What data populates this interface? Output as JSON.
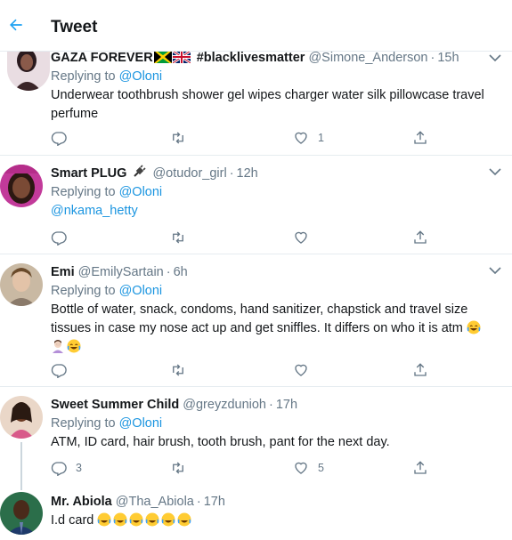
{
  "header": {
    "title": "Tweet",
    "back_icon": "arrow-left-icon",
    "accent": "#1da1f2"
  },
  "tweets": [
    {
      "name": "GAZA FOREVER",
      "suffix": "#blacklivesmatter",
      "handle": "@Simone_Anderson",
      "time": "15h",
      "replying_label": "Replying to",
      "replying_to": "@Oloni",
      "text": "Underwear toothbrush shower gel wipes charger water silk pillowcase travel perfume",
      "replies": "",
      "likes": "1"
    },
    {
      "name": "Smart PLUG",
      "handle": "@otudor_girl",
      "time": "12h",
      "replying_label": "Replying to",
      "replying_to": "@Oloni",
      "text": "@nkama_hetty",
      "replies": "",
      "likes": ""
    },
    {
      "name": "Emi",
      "handle": "@EmilySartain",
      "time": "6h",
      "replying_label": "Replying to",
      "replying_to": "@Oloni",
      "text": "Bottle of water, snack, condoms, hand sanitizer, chapstick and travel size tissues in case my nose act up and get sniffles. It differs on who it is atm",
      "replies": "",
      "likes": ""
    },
    {
      "name": "Sweet Summer Child",
      "handle": "@greyzdunioh",
      "time": "17h",
      "replying_label": "Replying to",
      "replying_to": "@Oloni",
      "text": "ATM, ID card, hair brush, tooth brush, pant for the next day.",
      "replies": "3",
      "likes": "5"
    },
    {
      "name": "Mr. Abiola",
      "handle": "@Tha_Abiola",
      "time": "17h",
      "text": "I.d card"
    }
  ],
  "colors": {
    "text": "#14171a",
    "secondary": "#657786",
    "link": "#1b95e0",
    "border": "#e6ecf0"
  }
}
